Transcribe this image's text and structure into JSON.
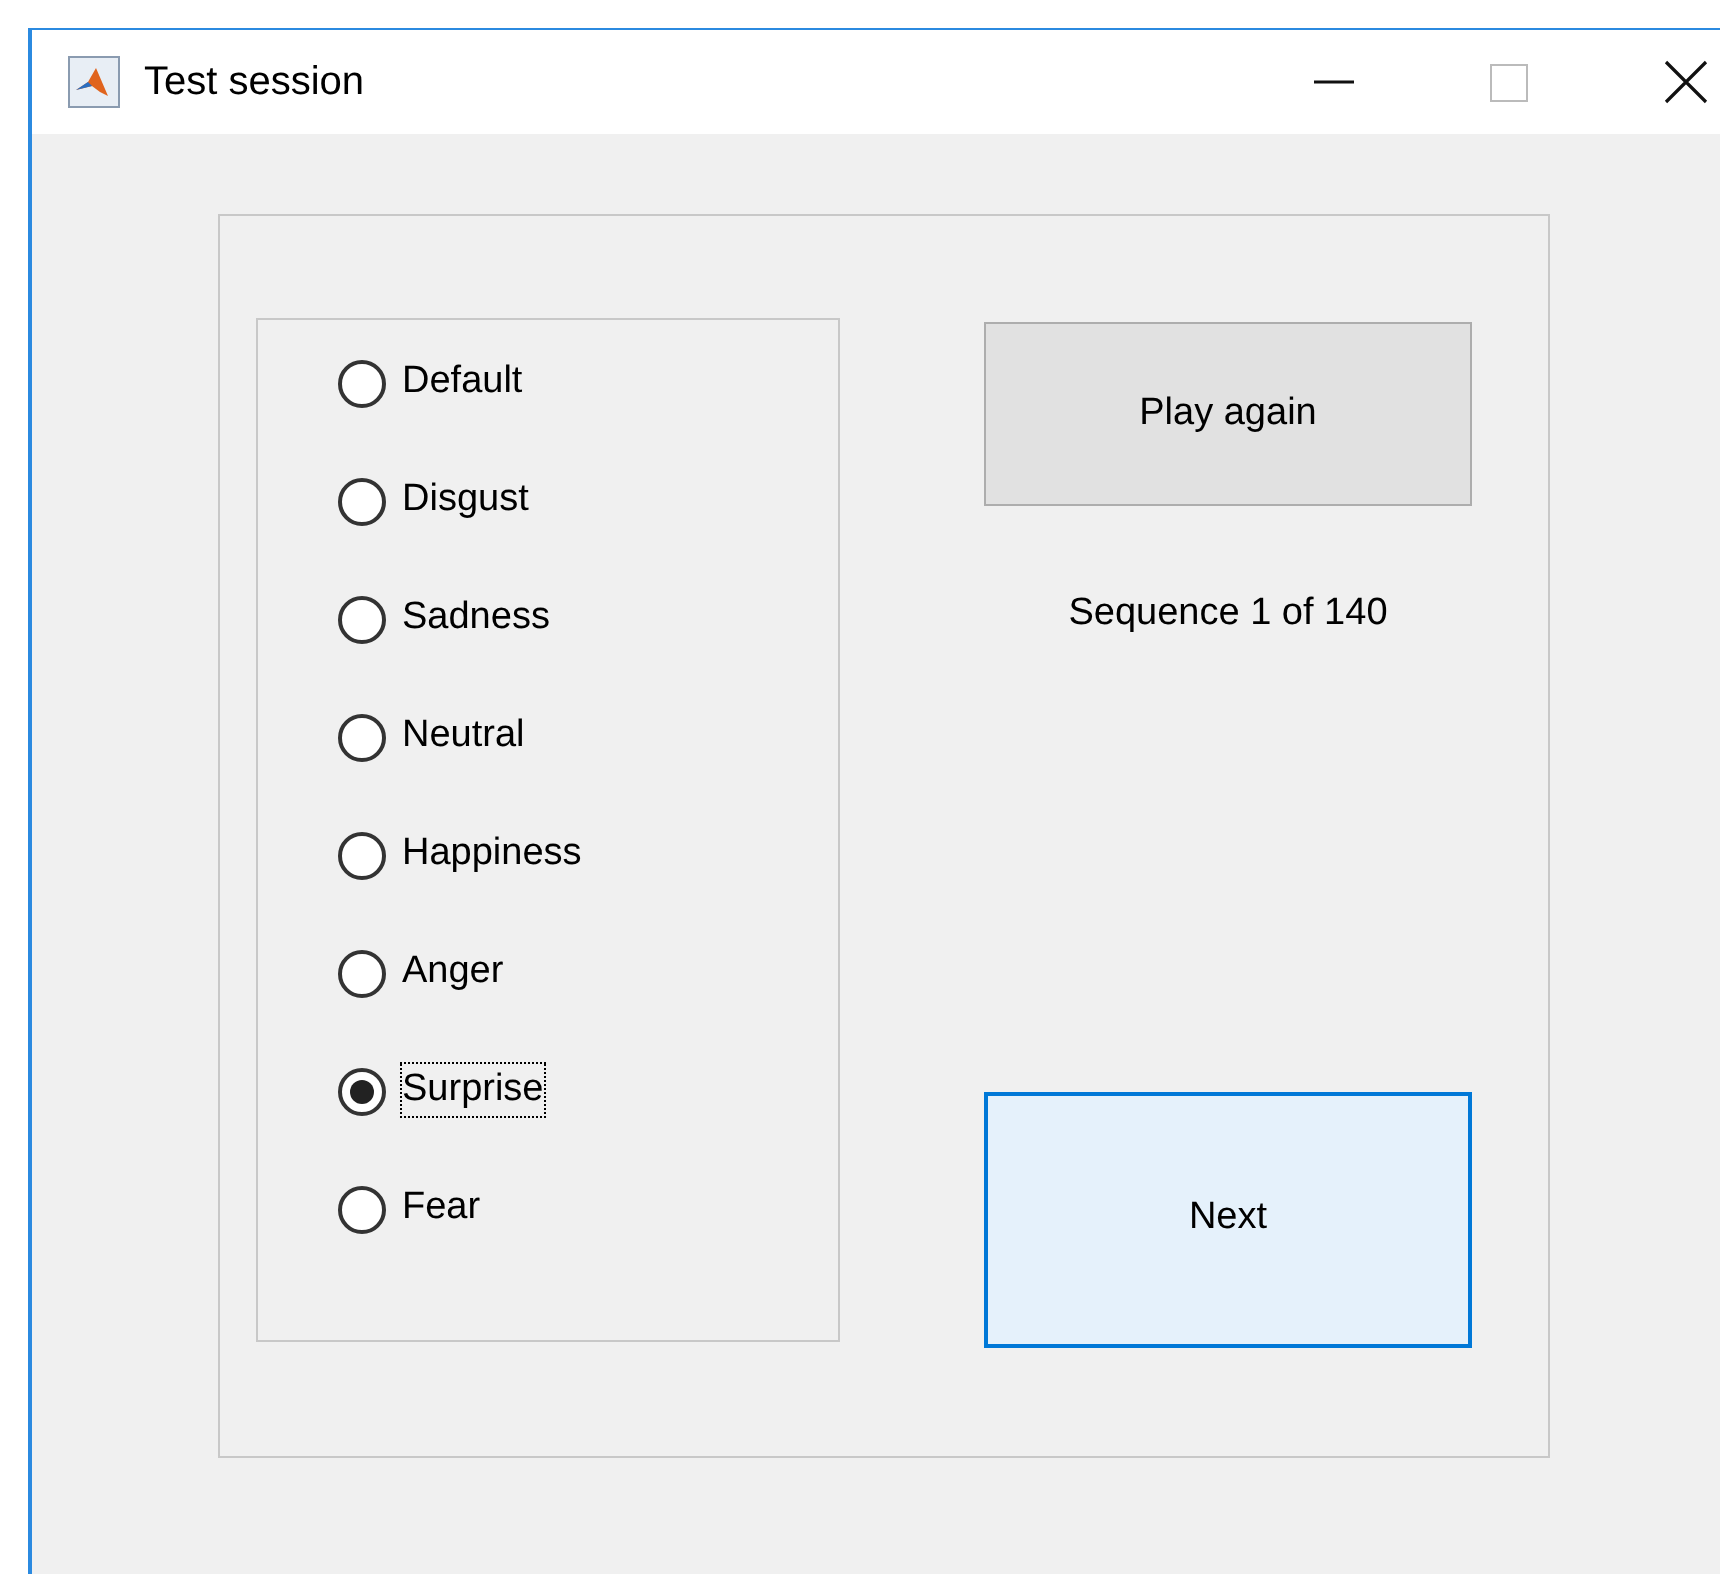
{
  "window": {
    "title": "Test session"
  },
  "emotions": [
    {
      "label": "Default",
      "selected": false
    },
    {
      "label": "Disgust",
      "selected": false
    },
    {
      "label": "Sadness",
      "selected": false
    },
    {
      "label": "Neutral",
      "selected": false
    },
    {
      "label": "Happiness",
      "selected": false
    },
    {
      "label": "Anger",
      "selected": false
    },
    {
      "label": "Surprise",
      "selected": true
    },
    {
      "label": "Fear",
      "selected": false
    }
  ],
  "play_button": "Play again",
  "sequence": "Sequence 1 of 140",
  "next_button": "Next"
}
